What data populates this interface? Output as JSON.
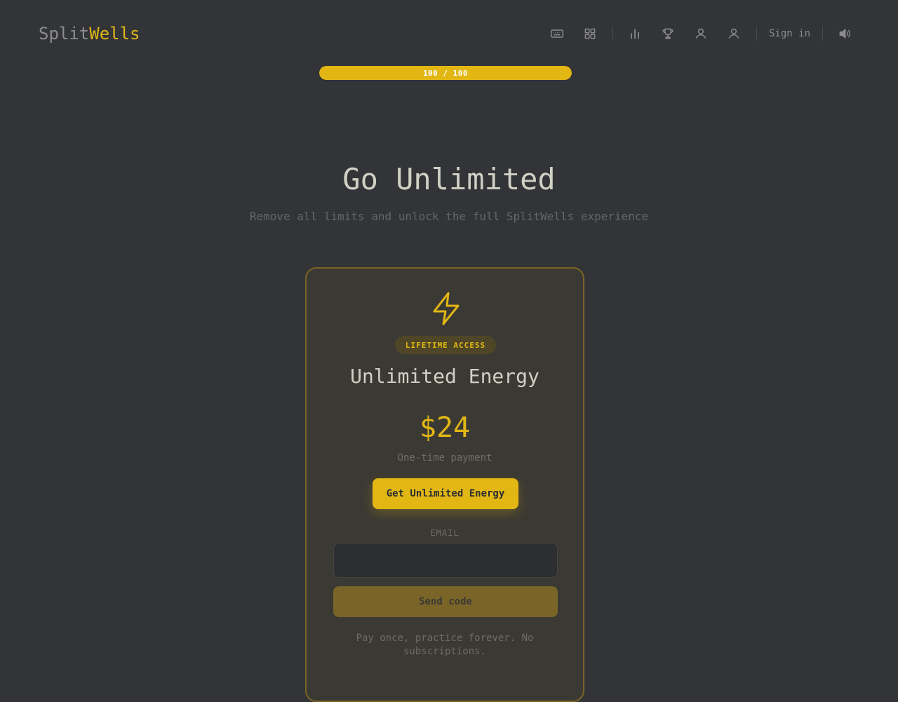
{
  "brand": {
    "part1": "Split",
    "part2": "Wells"
  },
  "nav": {
    "items": [
      {
        "icon": "keyboard-icon"
      },
      {
        "icon": "grid-icon"
      },
      {
        "icon": "bar-chart-icon"
      },
      {
        "icon": "trophy-icon"
      },
      {
        "icon": "user-icon"
      },
      {
        "icon": "user-icon"
      }
    ],
    "sign_in_label": "Sign in",
    "sound_icon": "volume-icon"
  },
  "energy": {
    "text": "100 / 100",
    "current": 100,
    "max": 100
  },
  "hero": {
    "title": "Go Unlimited",
    "subtitle": "Remove all limits and unlock the full SplitWells experience"
  },
  "card": {
    "icon": "lightning-bolt-icon",
    "badge": "LIFETIME ACCESS",
    "plan_name": "Unlimited Energy",
    "price": "$24",
    "price_note": "One-time payment",
    "cta_label": "Get Unlimited Energy",
    "email_label": "EMAIL",
    "email_value": "",
    "email_placeholder": "",
    "send_label": "Send code",
    "footnote": "Pay once, practice forever. No subscriptions."
  },
  "colors": {
    "background": "#323437",
    "accent": "#e2b714",
    "muted": "#646669",
    "text": "#d1d0c5"
  }
}
